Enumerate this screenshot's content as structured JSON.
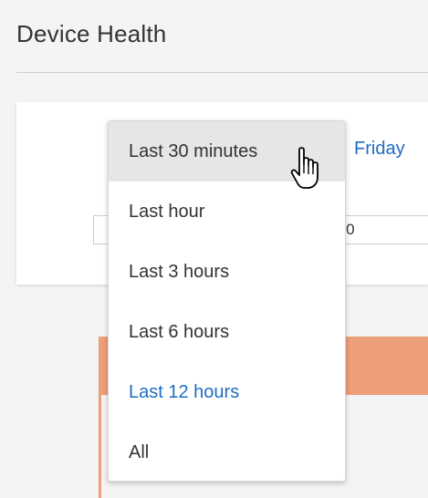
{
  "header": {
    "title": "Device Health"
  },
  "date_link": "Friday",
  "time_field": {
    "value": ":00"
  },
  "dropdown": {
    "items": [
      {
        "label": "Last 30 minutes",
        "state": "hover"
      },
      {
        "label": "Last hour",
        "state": "normal"
      },
      {
        "label": "Last 3 hours",
        "state": "normal"
      },
      {
        "label": "Last 6 hours",
        "state": "normal"
      },
      {
        "label": "Last 12 hours",
        "state": "selected"
      },
      {
        "label": "All",
        "state": "normal"
      }
    ]
  },
  "cursor_icon": "hand-pointer-icon",
  "colors": {
    "accent_link": "#1f6dc2",
    "chart_fill": "#ec9f79",
    "hover_bg": "#e6e6e6"
  }
}
